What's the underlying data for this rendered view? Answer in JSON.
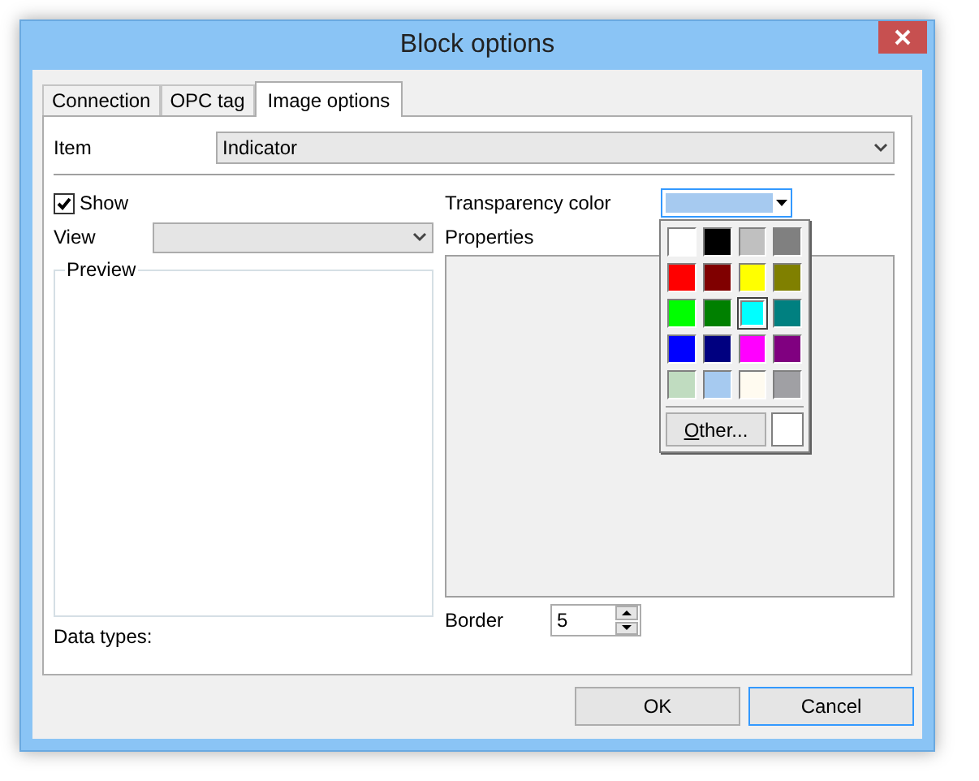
{
  "window": {
    "title": "Block options"
  },
  "tabs": [
    {
      "label": "Connection",
      "selected": false
    },
    {
      "label": "OPC tag",
      "selected": false
    },
    {
      "label": "Image options",
      "selected": true
    }
  ],
  "item": {
    "label": "Item",
    "value": "Indicator"
  },
  "show": {
    "label": "Show",
    "checked": true
  },
  "view": {
    "label": "View"
  },
  "preview": {
    "label": "Preview"
  },
  "data_types": {
    "label": "Data types:"
  },
  "transparency": {
    "label": "Transparency color",
    "color": "#a6caf0"
  },
  "palette": {
    "swatches": [
      {
        "color": "#ffffff",
        "selected": false
      },
      {
        "color": "#000000",
        "selected": false
      },
      {
        "color": "#c0c0c0",
        "selected": false
      },
      {
        "color": "#808080",
        "selected": false
      },
      {
        "color": "#ff0000",
        "selected": false
      },
      {
        "color": "#800000",
        "selected": false
      },
      {
        "color": "#ffff00",
        "selected": false
      },
      {
        "color": "#808000",
        "selected": false
      },
      {
        "color": "#00ff00",
        "selected": false
      },
      {
        "color": "#008000",
        "selected": false
      },
      {
        "color": "#00ffff",
        "selected": true
      },
      {
        "color": "#008080",
        "selected": false
      },
      {
        "color": "#0000ff",
        "selected": false
      },
      {
        "color": "#000080",
        "selected": false
      },
      {
        "color": "#ff00ff",
        "selected": false
      },
      {
        "color": "#800080",
        "selected": false
      },
      {
        "color": "#c0dcc0",
        "selected": false
      },
      {
        "color": "#a6caf0",
        "selected": false
      },
      {
        "color": "#fffbf0",
        "selected": false
      },
      {
        "color": "#a0a0a4",
        "selected": false
      }
    ],
    "other_button": "Other...",
    "custom": {
      "color": "#ffffff"
    }
  },
  "properties": {
    "label": "Properties"
  },
  "border": {
    "label": "Border",
    "value": "5"
  },
  "buttons": [
    {
      "label": "OK",
      "focused": false
    },
    {
      "label": "Cancel",
      "focused": true
    }
  ]
}
